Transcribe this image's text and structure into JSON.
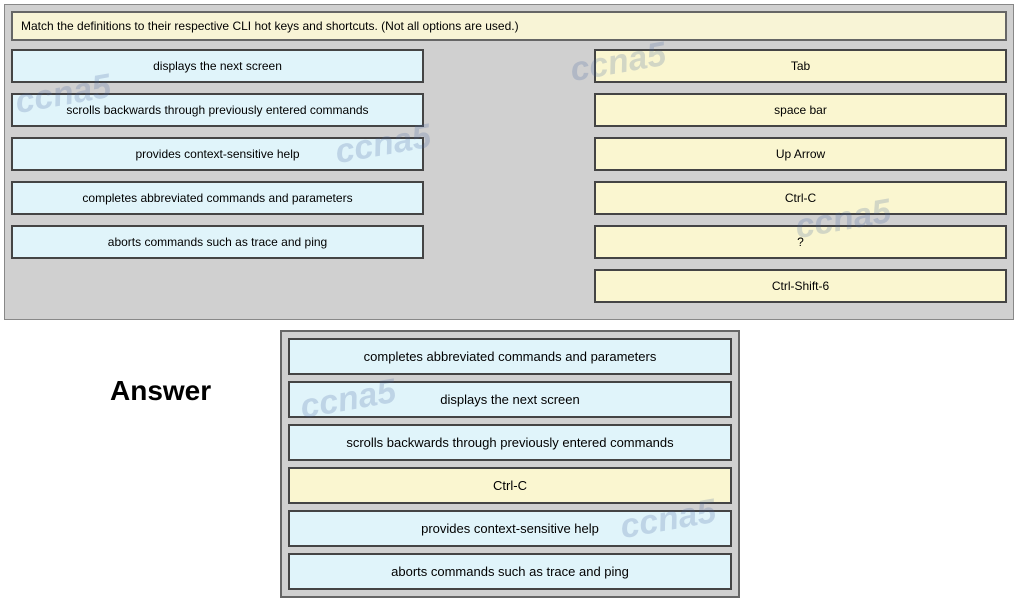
{
  "question": "Match the definitions to their respective CLI hot keys and shortcuts. (Not all options are used.)",
  "left_items": [
    "displays the next screen",
    "scrolls backwards through previously entered commands",
    "provides context-sensitive help",
    "completes abbreviated commands and parameters",
    "aborts commands such as trace and ping"
  ],
  "right_items": [
    "Tab",
    "space bar",
    "Up Arrow",
    "Ctrl-C",
    "?",
    "Ctrl-Shift-6"
  ],
  "answer_label": "Answer",
  "answer_items": [
    {
      "text": "completes abbreviated commands and parameters",
      "style": "blue"
    },
    {
      "text": "displays the next screen",
      "style": "blue"
    },
    {
      "text": "scrolls backwards through previously entered commands",
      "style": "blue"
    },
    {
      "text": "Ctrl-C",
      "style": "yellow"
    },
    {
      "text": "provides context-sensitive help",
      "style": "blue"
    },
    {
      "text": "aborts commands such as trace and ping",
      "style": "blue"
    }
  ],
  "watermark": "ccna5"
}
